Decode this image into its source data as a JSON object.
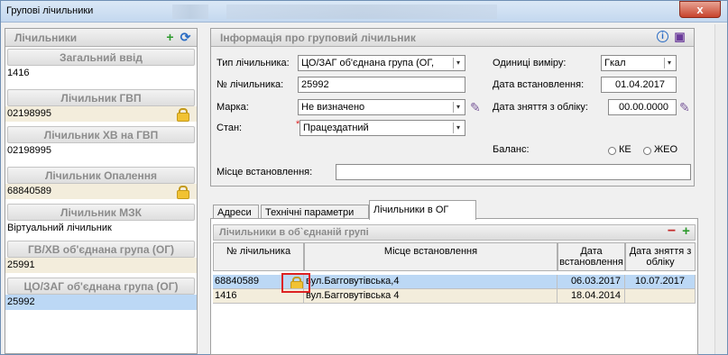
{
  "window": {
    "title": "Групові лічильники",
    "close_label": "x"
  },
  "left": {
    "header": "Лічильники",
    "groups": [
      {
        "name": "Загальний ввід",
        "value": "1416",
        "locked": false,
        "style": "white"
      },
      {
        "name": "Лічильник ГВП",
        "value": "02198995",
        "locked": true,
        "style": "beige"
      },
      {
        "name": "Лічильник ХВ на ГВП",
        "value": "02198995",
        "locked": false,
        "style": "white"
      },
      {
        "name": "Лічильник Опалення",
        "value": "68840589",
        "locked": true,
        "style": "beige"
      },
      {
        "name": "Лічильник МЗК",
        "value": "Віртуальний лічильник",
        "locked": false,
        "style": "white"
      },
      {
        "name": "ГВ/ХВ об'єднана група (ОГ)",
        "value": "25991",
        "locked": false,
        "style": "beige"
      },
      {
        "name": "ЦО/ЗАГ об'єднана група (ОГ)",
        "value": "25992",
        "locked": false,
        "style": "sel"
      }
    ]
  },
  "info": {
    "header": "Інформація про груповий лічильник",
    "type_label": "Тип лічильника:",
    "type_value": "ЦО/ЗАГ об'єднана група (ОГ,",
    "units_label": "Одиниці виміру:",
    "units_value": "Гкал",
    "number_label": "№ лічильника:",
    "number_value": "25992",
    "install_date_label": "Дата встановлення:",
    "install_date_value": "01.04.2017",
    "brand_label": "Марка:",
    "brand_value": "Не визначено",
    "removal_date_label": "Дата зняття з обліку:",
    "removal_date_value": "00.00.0000",
    "state_label": "Стан:",
    "state_required": "*",
    "state_value": "Працездатний",
    "balance_label": "Баланс:",
    "balance_opt1": "КЕ",
    "balance_opt2": "ЖЕО",
    "location_label": "Місце встановлення:",
    "location_value": ""
  },
  "tabs": [
    {
      "label": "Адреси"
    },
    {
      "label": "Технічні параметри"
    },
    {
      "label": "Лічильники в ОГ"
    }
  ],
  "og": {
    "header": "Лічильники в об`єднаній групі",
    "columns": [
      "№ лічильника",
      "Місце встановлення",
      "Дата встановлення",
      "Дата зняття з обліку"
    ],
    "rows": [
      {
        "number": "68840589",
        "location": "вул.Багговутівська,4",
        "install": "06.03.2017",
        "removal": "10.07.2017",
        "locked": true
      },
      {
        "number": "1416",
        "location": "вул.Багговутівська 4",
        "install": "18.04.2014",
        "removal": "",
        "locked": false
      }
    ]
  },
  "colors": {
    "selected": "#bcd8f5",
    "beige": "#f3eddc",
    "accent_green": "#2e9a2e",
    "highlight_red": "#dd2222"
  }
}
